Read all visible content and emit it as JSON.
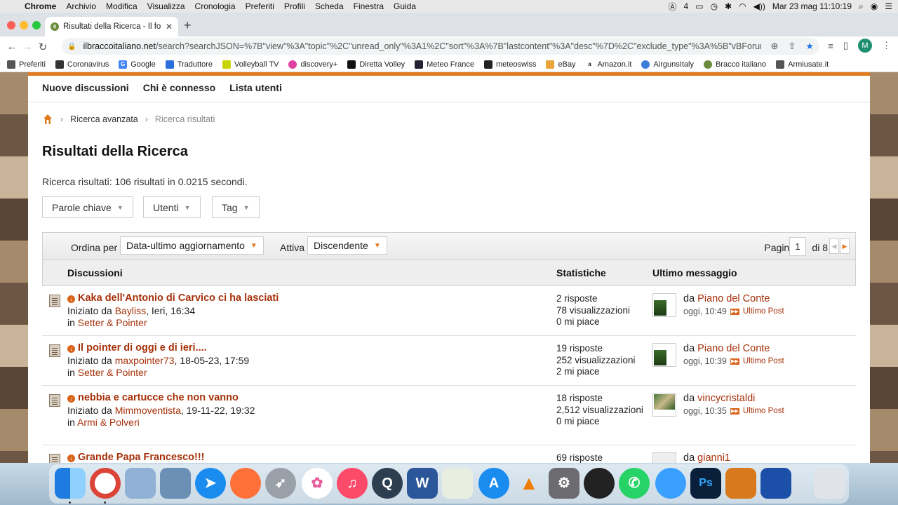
{
  "menubar": {
    "app": "Chrome",
    "items": [
      "Archivio",
      "Modifica",
      "Visualizza",
      "Cronologia",
      "Preferiti",
      "Profili",
      "Scheda",
      "Finestra",
      "Guida"
    ],
    "status": {
      "keyboard": "4",
      "datetime": "Mar 23 mag  11:10:19"
    }
  },
  "browser": {
    "tab_title": "Risultati della Ricerca - Il forum",
    "url_host": "ilbraccoitaliano.net",
    "url_path": "/search?searchJSON=%7B\"view\"%3A\"topic\"%2C\"unread_only\"%3A1%2C\"sort\"%3A%7B\"lastcontent\"%3A\"desc\"%7D%2C\"exclude_type\"%3A%5B\"vBForum_PrivateMes...",
    "profile_initial": "M",
    "bookmarks": [
      "Preferiti",
      "Coronavirus",
      "Google",
      "Traduttore",
      "Volleyball TV",
      "discovery+",
      "Diretta Volley",
      "Meteo France",
      "meteoswiss",
      "eBay",
      "Amazon.it",
      "AirgunsItaly",
      "Bracco italiano",
      "Armiusate.it"
    ]
  },
  "nav": {
    "items": [
      "Nuove discussioni",
      "Chi è connesso",
      "Lista utenti"
    ]
  },
  "breadcrumb": {
    "items": [
      "Ricerca avanzata",
      "Ricerca risultati"
    ]
  },
  "page": {
    "title": "Risultati della Ricerca",
    "result_count": "Ricerca risultati: 106 risultati in 0.0215 secondi.",
    "filters": [
      "Parole chiave",
      "Utenti",
      "Tag"
    ]
  },
  "sort": {
    "order_label": "Ordina per",
    "order_value": "Data-ultimo aggiornamento",
    "dir_label": "Attiva",
    "dir_value": "Discendente",
    "page_label": "Pagina",
    "page_value": "1",
    "page_total": "di 8"
  },
  "columns": {
    "discussions": "Discussioni",
    "stats": "Statistiche",
    "last": "Ultimo messaggio"
  },
  "threads": [
    {
      "title": "Kaka dell'Antonio di Carvico ci ha lasciati",
      "started_prefix": "Iniziato da",
      "author": "Bayliss",
      "date": ", Ieri, 16:34",
      "forum_prefix": "in",
      "forum": "Setter & Pointer",
      "replies": "2 risposte",
      "views": "78 visualizzazioni",
      "likes": "0 mi piace",
      "last_prefix": "da",
      "last_user": "Piano del Conte",
      "last_time": "oggi, 10:49",
      "last_link": "Ultimo Post"
    },
    {
      "title": "Il pointer di oggi e di ieri....",
      "started_prefix": "Iniziato da",
      "author": "maxpointer73",
      "date": ", 18-05-23, 17:59",
      "forum_prefix": "in",
      "forum": "Setter & Pointer",
      "replies": "19 risposte",
      "views": "252 visualizzazioni",
      "likes": "2 mi piace",
      "last_prefix": "da",
      "last_user": "Piano del Conte",
      "last_time": "oggi, 10:39",
      "last_link": "Ultimo Post"
    },
    {
      "title": "nebbia e cartucce che non vanno",
      "started_prefix": "Iniziato da",
      "author": "Mimmoventista",
      "date": ", 19-11-22, 19:32",
      "forum_prefix": "in",
      "forum": "Armi & Polveri",
      "replies": "18 risposte",
      "views": "2,512 visualizzazioni",
      "likes": "0 mi piace",
      "last_prefix": "da",
      "last_user": "vincycristaldi",
      "last_time": "oggi, 10:35",
      "last_link": "Ultimo Post"
    },
    {
      "title": "Grande Papa Francesco!!!",
      "replies": "69 risposte",
      "last_prefix": "da",
      "last_user": "gianni1"
    }
  ],
  "colors": {
    "accent": "#e07b20",
    "link": "#a6310a"
  },
  "dock": [
    "finder-icon",
    "chrome-icon",
    "preview-icon",
    "photos-viewer-icon",
    "safari-icon",
    "firefox-icon",
    "launchpad-icon",
    "photos-icon",
    "music-icon",
    "quicktime-icon",
    "word-icon",
    "maps-icon",
    "app-store-icon",
    "vlc-icon",
    "system-preferences-icon",
    "photo-booth-icon",
    "whatsapp-icon",
    "messages-icon",
    "photoshop-icon",
    "calculator-icon",
    "keyboard-viewer-icon",
    "trash-icon"
  ]
}
